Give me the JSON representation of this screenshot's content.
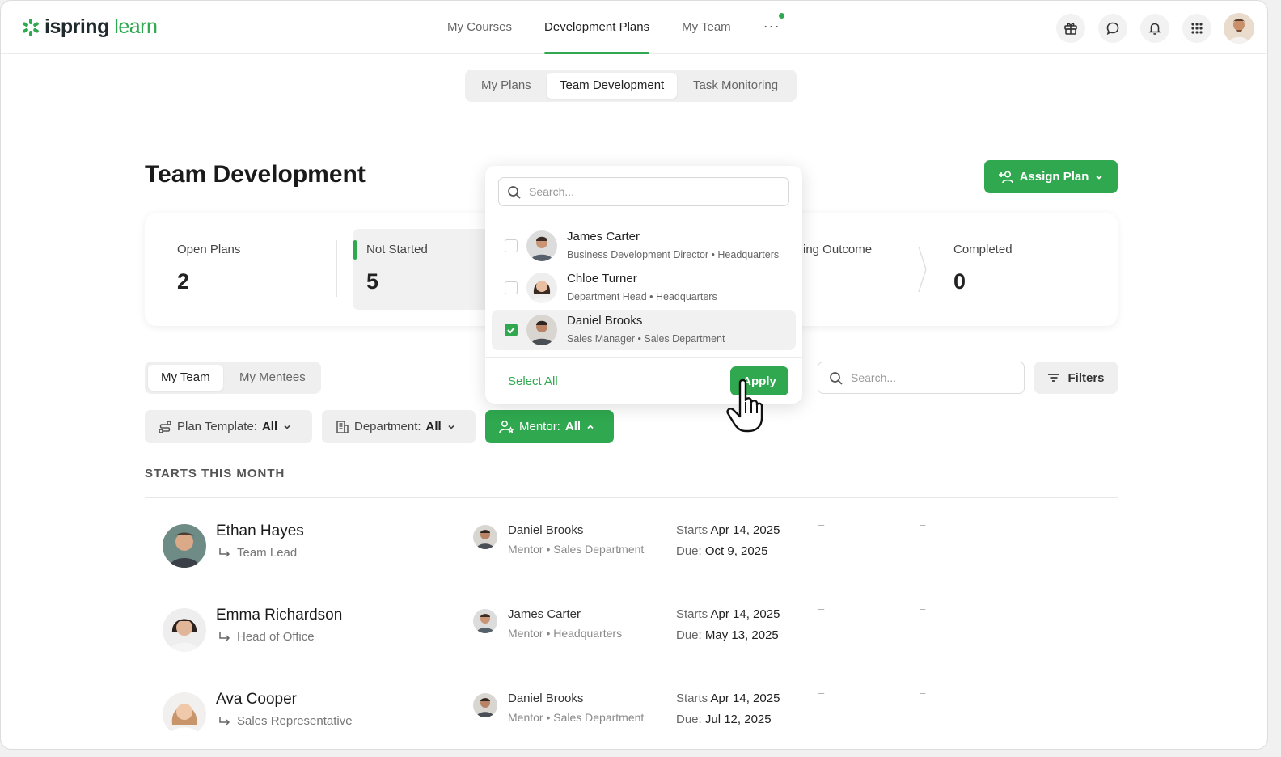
{
  "app": {
    "logo_brand": "ispring",
    "logo_product": "learn"
  },
  "nav": {
    "items": [
      "My Courses",
      "Development Plans",
      "My Team"
    ],
    "more": "···",
    "active": "Development Plans"
  },
  "top_icons": [
    "gift-icon",
    "chat-icon",
    "bell-icon",
    "apps-grid-icon"
  ],
  "subtabs": {
    "items": [
      "My Plans",
      "Team Development",
      "Task Monitoring"
    ],
    "active": "Team Development"
  },
  "page": {
    "title": "Team Development",
    "assign_button": "Assign Plan"
  },
  "stats": {
    "open_plans": {
      "label": "Open Plans",
      "value": "2"
    },
    "not_started": {
      "label": "Not Started",
      "value": "5"
    },
    "outcome_label_partial": "ing Outcome",
    "completed": {
      "label": "Completed",
      "value": "0"
    }
  },
  "team_tabs": {
    "items": [
      "My Team",
      "My Mentees"
    ],
    "active": "My Team"
  },
  "search": {
    "placeholder": "Search..."
  },
  "filters_button": "Filters",
  "filter_chips": {
    "plan_template": {
      "label": "Plan Template:",
      "value": "All"
    },
    "department": {
      "label": "Department:",
      "value": "All"
    },
    "mentor": {
      "label": "Mentor:",
      "value": "All"
    }
  },
  "section_label": "STARTS THIS MONTH",
  "rows": [
    {
      "name": "Ethan Hayes",
      "role": "Team Lead",
      "mentor": "Daniel Brooks",
      "mentor_sub": "Mentor • Sales Department",
      "starts_label": "Starts",
      "starts": "Apr 14, 2025",
      "due_label": "Due:",
      "due": "Oct 9, 2025",
      "dash1": "–",
      "dash2": "–"
    },
    {
      "name": "Emma Richardson",
      "role": "Head of Office",
      "mentor": "James Carter",
      "mentor_sub": "Mentor • Headquarters",
      "starts_label": "Starts",
      "starts": "Apr 14, 2025",
      "due_label": "Due:",
      "due": "May 13, 2025",
      "dash1": "–",
      "dash2": "–"
    },
    {
      "name": "Ava Cooper",
      "role": "Sales Representative",
      "mentor": "Daniel Brooks",
      "mentor_sub": "Mentor • Sales Department",
      "starts_label": "Starts",
      "starts": "Apr 14, 2025",
      "due_label": "Due:",
      "due": "Jul 12, 2025",
      "dash1": "–",
      "dash2": "–"
    }
  ],
  "mentor_dropdown": {
    "search_placeholder": "Search...",
    "options": [
      {
        "name": "James Carter",
        "sub": "Business Development Director • Headquarters",
        "checked": false
      },
      {
        "name": "Chloe Turner",
        "sub": "Department Head • Headquarters",
        "checked": false
      },
      {
        "name": "Daniel Brooks",
        "sub": "Sales Manager • Sales Department",
        "checked": true
      }
    ],
    "select_all": "Select All",
    "apply": "Apply"
  },
  "colors": {
    "accent": "#2fa84f",
    "text": "#222222",
    "muted": "#777777",
    "surface": "#efefef"
  }
}
